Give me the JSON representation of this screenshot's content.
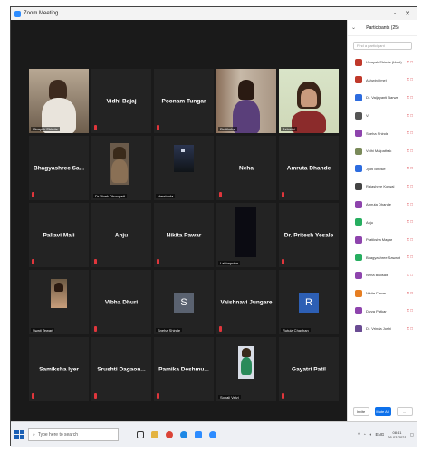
{
  "window": {
    "title": "Zoom Meeting",
    "minimize": "–",
    "maximize": "▫",
    "close": "✕"
  },
  "tiles": [
    {
      "name": "Vinayak Shinde",
      "video": "man-indoor",
      "active": false,
      "show_name": false
    },
    {
      "name": "Vidhi Bajaj",
      "video": "",
      "active": false,
      "show_name": true
    },
    {
      "name": "Poonam Tungar",
      "video": "",
      "active": false,
      "show_name": true
    },
    {
      "name": "Pratiksha",
      "video": "woman-curtain",
      "active": false,
      "show_name": false
    },
    {
      "name": "Ashwini",
      "video": "woman-green",
      "active": true,
      "show_name": false
    },
    {
      "name": "Bhagyashree Sa...",
      "video": "",
      "active": false,
      "show_name": true
    },
    {
      "name": "Dr Vivek Dhongadi",
      "video": "man-small",
      "active": false,
      "show_name": false
    },
    {
      "name": "Harshada",
      "video": "dark-room",
      "active": false,
      "show_name": false
    },
    {
      "name": "Neha",
      "video": "",
      "active": false,
      "show_name": true
    },
    {
      "name": "Amruta Dhande",
      "video": "",
      "active": false,
      "show_name": true
    },
    {
      "name": "Pallavi Mali",
      "video": "",
      "active": false,
      "show_name": true
    },
    {
      "name": "Anju",
      "video": "",
      "active": false,
      "show_name": true
    },
    {
      "name": "Nikita Pawar",
      "video": "",
      "active": false,
      "show_name": true
    },
    {
      "name": "Lakhaputra",
      "video": "dark-box",
      "active": false,
      "show_name": false
    },
    {
      "name": "Dr. Pritesh Yesale",
      "video": "",
      "active": false,
      "show_name": true
    },
    {
      "name": "Swati Tewari",
      "video": "woman-photo",
      "active": false,
      "show_name": false
    },
    {
      "name": "Vibha Dhuri",
      "video": "",
      "active": false,
      "show_name": true
    },
    {
      "name": "Sneha Shinde",
      "video": "avatar-S",
      "active": false,
      "show_name": false,
      "avatar_letter": "S"
    },
    {
      "name": "Vaishnavi Jungare",
      "video": "",
      "active": false,
      "show_name": true
    },
    {
      "name": "Rutuja Chavhan",
      "video": "avatar-R",
      "active": false,
      "show_name": false,
      "avatar_letter": "R"
    },
    {
      "name": "Samiksha Iyer",
      "video": "",
      "active": false,
      "show_name": true
    },
    {
      "name": "Srushti Dagaon...",
      "video": "",
      "active": false,
      "show_name": true
    },
    {
      "name": "Pamika Deshmu...",
      "video": "",
      "active": false,
      "show_name": true
    },
    {
      "name": "Sonali Valvi",
      "video": "man-standing",
      "active": false,
      "show_name": false
    },
    {
      "name": "Gayatri Patil",
      "video": "",
      "active": false,
      "show_name": true
    }
  ],
  "sidebar": {
    "title": "Participants (25)",
    "search_placeholder": "Find a participant",
    "participants": [
      {
        "name": "Vinayak Shinde (Host)",
        "color": "#c0392b"
      },
      {
        "name": "Ashwini (me)",
        "color": "#c0392b"
      },
      {
        "name": "Dr. Vaijayanti Barwe",
        "color": "#2d6cdf"
      },
      {
        "name": "Vi",
        "color": "#555555"
      },
      {
        "name": "Sneha Shinde",
        "color": "#8e44ad"
      },
      {
        "name": "Vidhi Malpathak",
        "color": "#7a8a5a"
      },
      {
        "name": "Jyoti Bhosle",
        "color": "#2d6cdf"
      },
      {
        "name": "Rajashree Kotwal",
        "color": "#444444"
      },
      {
        "name": "Amruta Dhande",
        "color": "#8e44ad"
      },
      {
        "name": "Anju",
        "color": "#27ae60"
      },
      {
        "name": "Pratiksha Magar",
        "color": "#8e44ad"
      },
      {
        "name": "Bhagyashree Sawant",
        "color": "#27ae60"
      },
      {
        "name": "Neha Bhosale",
        "color": "#8e44ad"
      },
      {
        "name": "Nikita Pawar",
        "color": "#e67e22"
      },
      {
        "name": "Divya Patkar",
        "color": "#8e44ad"
      },
      {
        "name": "Dr. Vrinda Joshi",
        "color": "#6a4c93"
      }
    ],
    "invite_label": "Invite",
    "mute_all_label": "Mute All",
    "more_label": "..."
  },
  "taskbar": {
    "search_placeholder": "Type here to search",
    "time": "08:41",
    "date": "26-03-2021",
    "lang": "ENG"
  }
}
